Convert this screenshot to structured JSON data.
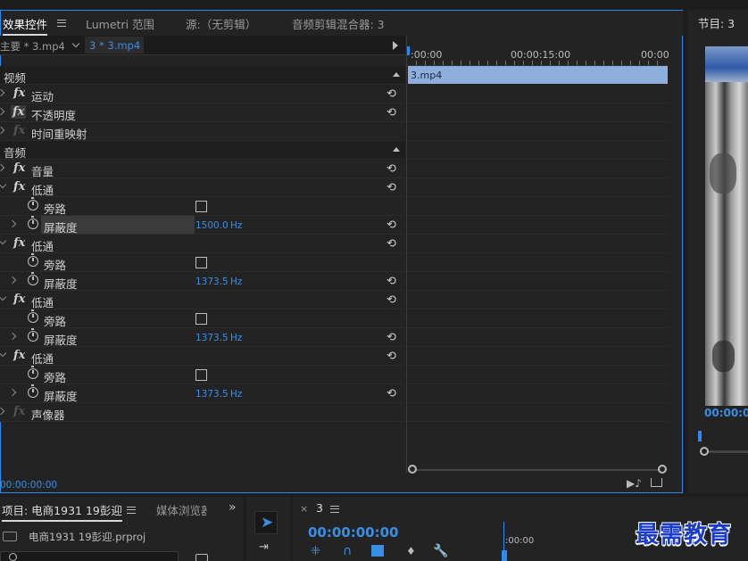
{
  "tabs": {
    "effect_controls": "效果控件",
    "lumetri": "Lumetri 范围",
    "source": "源:（无剪辑）",
    "audio_mixer": "音频剪辑混合器: 3",
    "program": "节目: 3"
  },
  "clip_bar": {
    "master": "主要 * 3.mp4",
    "clip": "3 * 3.mp4"
  },
  "timeline": {
    "time_start": ":00:00",
    "time_mid": "00:00:15:00",
    "time_end": "00:00",
    "clip_name": "3.mp4",
    "current_time": "00:00:00:00"
  },
  "sections": {
    "video": "视频",
    "audio": "音频"
  },
  "effects": {
    "motion": "运动",
    "opacity": "不透明度",
    "time_remap": "时间重映射",
    "volume": "音量",
    "lowpass": "低通",
    "bypass": "旁路",
    "cutoff": "屏蔽度",
    "panner": "声像器",
    "unit": "Hz",
    "cutoff_values": [
      "1500.0",
      "1373.5",
      "1373.5",
      "1373.5"
    ]
  },
  "program_monitor": {
    "timecode": "00:00:0"
  },
  "project": {
    "title": "项目: 电商1931  19彭迎",
    "media_browser": "媒体浏览器",
    "file": "电商1931  19彭迎.prproj"
  },
  "sequence": {
    "name": "3",
    "timecode": "00:00:00:00",
    "ruler_time": ":00:00"
  },
  "watermark": "最需教育"
}
